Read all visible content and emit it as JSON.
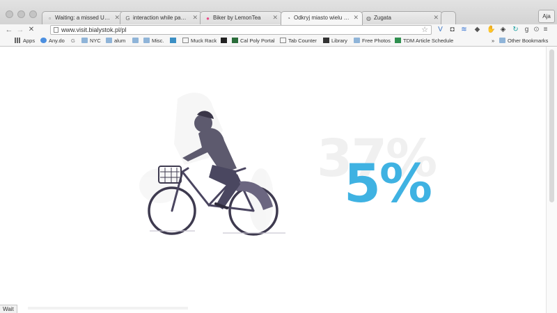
{
  "browser": {
    "tabs": [
      {
        "title": "Waiting: a missed UX opp...",
        "icon": "doc-icon"
      },
      {
        "title": "interaction while page load...",
        "icon": "google-icon"
      },
      {
        "title": "Biker by LemonTea",
        "icon": "dribbble-icon"
      },
      {
        "title": "Odkryj miasto wielu kultur",
        "icon": "loading-icon"
      },
      {
        "title": "Zugata",
        "icon": "globe-icon"
      }
    ],
    "profile": "Aja",
    "url": "www.visit.bialystok.pl/pl"
  },
  "bookmarks": [
    {
      "label": "Apps",
      "icon": "apps-icon"
    },
    {
      "label": "Any.do",
      "icon": "anydo-icon"
    },
    {
      "label": "",
      "icon": "google-icon"
    },
    {
      "label": "NYC",
      "icon": "folder-icon"
    },
    {
      "label": "alum",
      "icon": "folder-icon"
    },
    {
      "label": "",
      "icon": "folder-icon"
    },
    {
      "label": "Misc.",
      "icon": "folder-icon"
    },
    {
      "label": "",
      "icon": "wordpress-icon"
    },
    {
      "label": "Muck Rack",
      "icon": "page-icon"
    },
    {
      "label": "",
      "icon": "medium-icon"
    },
    {
      "label": "Cal Poly Portal",
      "icon": "calpoly-icon"
    },
    {
      "label": "Tab Counter",
      "icon": "page-icon"
    },
    {
      "label": "Library",
      "icon": "library-icon"
    },
    {
      "label": "Free Photos",
      "icon": "folder-icon"
    },
    {
      "label": "TDM Article Schedule",
      "icon": "sheet-icon"
    }
  ],
  "bookmarks_overflow": "»",
  "other_bookmarks": "Other Bookmarks",
  "page": {
    "loading_percent": "5%",
    "previous_percent": "37%"
  },
  "status_text": "Wait",
  "colors": {
    "accent": "#3fb2e2"
  }
}
